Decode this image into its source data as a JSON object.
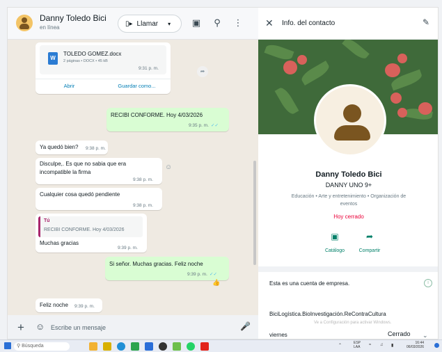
{
  "chat": {
    "contact_name": "Danny Toledo Bici",
    "status": "en línea",
    "call_label": "Llamar",
    "call_icon": "video-camera-icon",
    "header_icons": [
      "catalog-icon",
      "search-icon",
      "more-icon"
    ]
  },
  "messages": {
    "doc": {
      "filename": "TOLEDO GOMEZ.docx",
      "meta": "2 páginas • DOCX • 45 kB",
      "time": "9:31 p. m.",
      "open": "Abrir",
      "save": "Guardar como..."
    },
    "m1": {
      "text": "RECIBI CONFORME. Hoy 4/03/2026",
      "time": "9:35 p. m."
    },
    "m2": {
      "text": "Ya quedó bien?",
      "time": "9:38 p. m."
    },
    "m3": {
      "line1": "Disculpe,. Es que no sabia que era",
      "line2": "incompatible la firma",
      "time": "9:38 p. m."
    },
    "m4": {
      "text": "Cualquier cosa quedó pendiente",
      "time": "9:38 p. m."
    },
    "m5": {
      "reply_name": "Tú",
      "reply_text": "RECIBI CONFORME. Hoy 4/03/2026",
      "text": "Muchas gracias",
      "time": "9:39 p. m."
    },
    "m6": {
      "text": "Si señor. Muchas gracias. Feliz noche",
      "time": "9:39 p. m."
    },
    "m7": {
      "text": "Feliz noche",
      "time": "9:39 p. m."
    }
  },
  "compose": {
    "placeholder": "Escribe un mensaje"
  },
  "info": {
    "title": "Info. del contacto",
    "name": "Danny Toledo Bici",
    "subtitle": "DANNY UNO 9+",
    "category_line1": "Educación • Arte y entretenimiento • Organización de",
    "category_line2": "eventos",
    "hours_status": "Hoy cerrado",
    "catalog": "Catálogo",
    "share": "Compartir",
    "business_note": "Esta es una cuenta de empresa.",
    "tags": "BiciLogística.BioInvestigación.ReContraCultura",
    "watermark": "Ve a Configuración para activar Windows.",
    "day": "viernes",
    "day_status": "Cerrado"
  },
  "taskbar": {
    "search": "Búsqueda",
    "lang1": "ESP",
    "lang2": "LAA",
    "clock_time": "16:44",
    "clock_date": "06/03/2026"
  },
  "colors": {
    "accent": "#008069",
    "outgoing": "#d9fdd3",
    "closed": "#ea0038",
    "chat_bg": "#efeae2"
  }
}
